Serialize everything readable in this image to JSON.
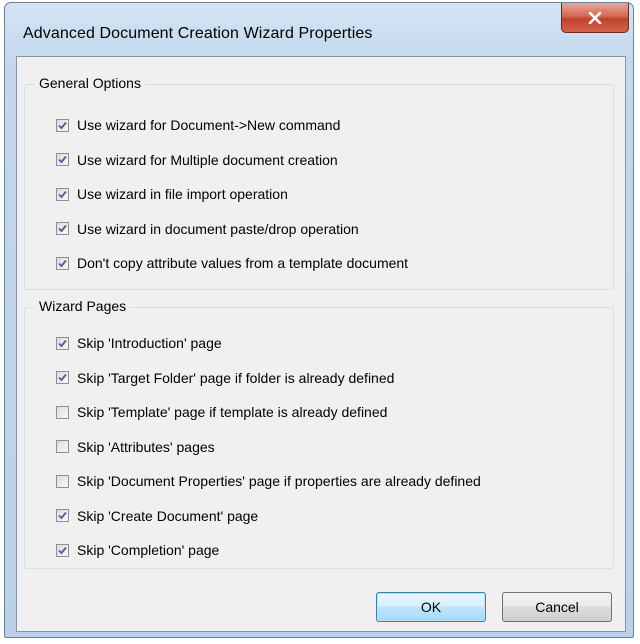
{
  "window": {
    "title": "Advanced Document Creation Wizard Properties",
    "close_icon": "close-x-icon",
    "accent": "#c7432b"
  },
  "general_options": {
    "label": "General Options",
    "items": [
      {
        "label": "Use wizard for Document->New command",
        "checked": true
      },
      {
        "label": "Use wizard for Multiple document creation",
        "checked": true
      },
      {
        "label": "Use wizard in file import operation",
        "checked": true
      },
      {
        "label": "Use wizard in document paste/drop operation",
        "checked": true
      },
      {
        "label": "Don't copy attribute values from a template document",
        "checked": true
      }
    ]
  },
  "wizard_pages": {
    "label": "Wizard Pages",
    "items": [
      {
        "label": "Skip 'Introduction' page",
        "checked": true
      },
      {
        "label": "Skip 'Target Folder' page if folder is already defined",
        "checked": true
      },
      {
        "label": "Skip 'Template' page if template is already defined",
        "checked": false
      },
      {
        "label": "Skip 'Attributes' pages",
        "checked": false
      },
      {
        "label": "Skip 'Document Properties' page if properties are already defined",
        "checked": false
      },
      {
        "label": "Skip 'Create Document' page",
        "checked": true
      },
      {
        "label": "Skip 'Completion' page",
        "checked": true
      }
    ]
  },
  "buttons": {
    "ok": "OK",
    "cancel": "Cancel"
  }
}
